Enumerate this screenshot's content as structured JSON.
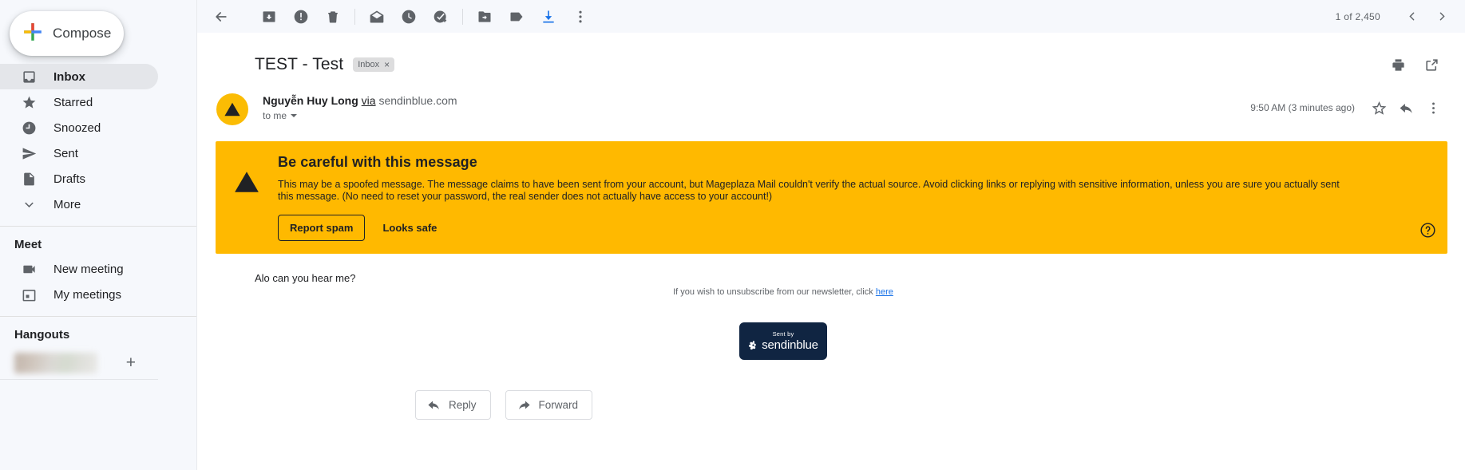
{
  "sidebar": {
    "compose": {
      "label": "Compose",
      "icon": "plus-icon"
    },
    "items": [
      {
        "label": "Inbox",
        "icon": "inbox-icon",
        "active": true
      },
      {
        "label": "Starred",
        "icon": "star-icon",
        "active": false
      },
      {
        "label": "Snoozed",
        "icon": "clock-icon",
        "active": false
      },
      {
        "label": "Sent",
        "icon": "send-icon",
        "active": false
      },
      {
        "label": "Drafts",
        "icon": "document-icon",
        "active": false
      },
      {
        "label": "More",
        "icon": "chevron-down-icon",
        "active": false
      }
    ],
    "meet": {
      "title": "Meet",
      "items": [
        {
          "label": "New meeting",
          "icon": "video-camera-icon"
        },
        {
          "label": "My meetings",
          "icon": "calendar-icon"
        }
      ]
    },
    "hangouts": {
      "title": "Hangouts",
      "profile_redacted": true,
      "add_label": "+"
    }
  },
  "toolbar": {
    "buttons": [
      {
        "name": "back-button",
        "icon": "arrow-left-icon",
        "tooltip": "Back to Inbox"
      },
      {
        "name": "archive-button",
        "icon": "archive-icon",
        "tooltip": "Archive"
      },
      {
        "name": "report-spam-button",
        "icon": "report-spam-icon",
        "tooltip": "Report spam"
      },
      {
        "name": "delete-button",
        "icon": "trash-icon",
        "tooltip": "Delete"
      },
      {
        "name": "mark-unread-button",
        "icon": "mail-icon",
        "tooltip": "Mark as unread"
      },
      {
        "name": "snooze-button",
        "icon": "clock-icon",
        "tooltip": "Snooze"
      },
      {
        "name": "add-to-tasks-button",
        "icon": "add-task-icon",
        "tooltip": "Add to Tasks"
      },
      {
        "name": "move-to-button",
        "icon": "folder-move-icon",
        "tooltip": "Move to"
      },
      {
        "name": "labels-button",
        "icon": "label-icon",
        "tooltip": "Labels"
      },
      {
        "name": "download-button",
        "icon": "download-icon",
        "tooltip": "Download"
      },
      {
        "name": "more-options-button",
        "icon": "more-vertical-icon",
        "tooltip": "More"
      }
    ],
    "download_color": "#1a73e8",
    "pager": {
      "count": "1 of 2,450",
      "prev_icon": "chevron-left-icon",
      "next_icon": "chevron-right-icon"
    }
  },
  "thread": {
    "subject": "TEST - Test",
    "label_chip": {
      "text": "Inbox",
      "remove": "×"
    },
    "print_icon": "print-icon",
    "open_in_new_icon": "open-in-new-icon",
    "sender": {
      "name": "Nguyễn Huy Long",
      "via": "via",
      "domain": "sendinblue.com",
      "to": "to me",
      "avatar_icon": "warning-triangle-icon",
      "avatar_color": "#fbbc04"
    },
    "timestamp": "9:50 AM (3 minutes ago)",
    "star_icon": "star-outline-icon",
    "reply_icon": "reply-icon",
    "more_icon": "more-vertical-icon"
  },
  "warning_banner": {
    "background": "#ffb900",
    "icon": "warning-triangle-icon",
    "title": "Be careful with this message",
    "text": "This may be a spoofed message. The message claims to have been sent from your account, but Mageplaza Mail couldn't verify the actual source. Avoid clicking links or replying with sensitive information, unless you are sure you actually sent this message. (No need to reset your password, the real sender does not actually have access to your account!)",
    "report_spam_label": "Report spam",
    "looks_safe_label": "Looks safe",
    "help_icon": "help-circle-icon"
  },
  "message": {
    "body": "Alo can you hear me?",
    "unsubscribe_prefix": "If you wish to unsubscribe from our newsletter, click ",
    "unsubscribe_link": "here",
    "sendinblue_badge": {
      "sent_by": "Sent by",
      "brand": "sendinblue",
      "background": "#102542",
      "logo_icon": "sendinblue-pinwheel-icon"
    }
  },
  "footer": {
    "reply": {
      "label": "Reply",
      "icon": "reply-icon"
    },
    "forward": {
      "label": "Forward",
      "icon": "forward-icon"
    }
  }
}
